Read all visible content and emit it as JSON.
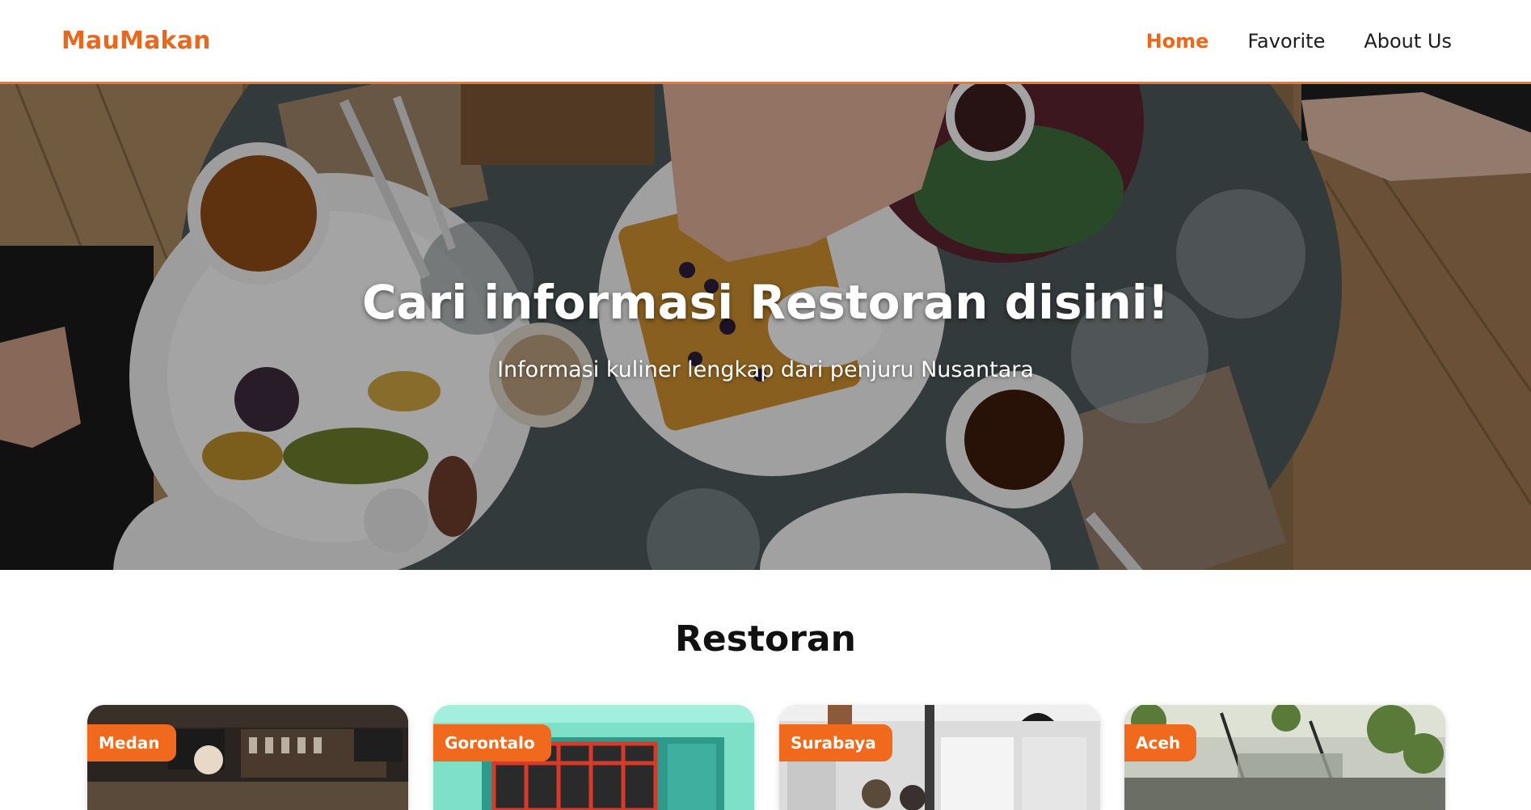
{
  "navbar": {
    "brand": "MauMakan",
    "links": [
      {
        "label": "Home",
        "active": true
      },
      {
        "label": "Favorite",
        "active": false
      },
      {
        "label": "About Us",
        "active": false
      }
    ]
  },
  "hero": {
    "title": "Cari informasi Restoran disini!",
    "subtitle": "Informasi kuliner lengkap dari penjuru Nusantara"
  },
  "restaurants": {
    "section_title": "Restoran",
    "cards": [
      {
        "city": "Medan"
      },
      {
        "city": "Gorontalo"
      },
      {
        "city": "Surabaya"
      },
      {
        "city": "Aceh"
      }
    ]
  },
  "colors": {
    "accent": "#f0691d",
    "brand": "#e8691d"
  }
}
